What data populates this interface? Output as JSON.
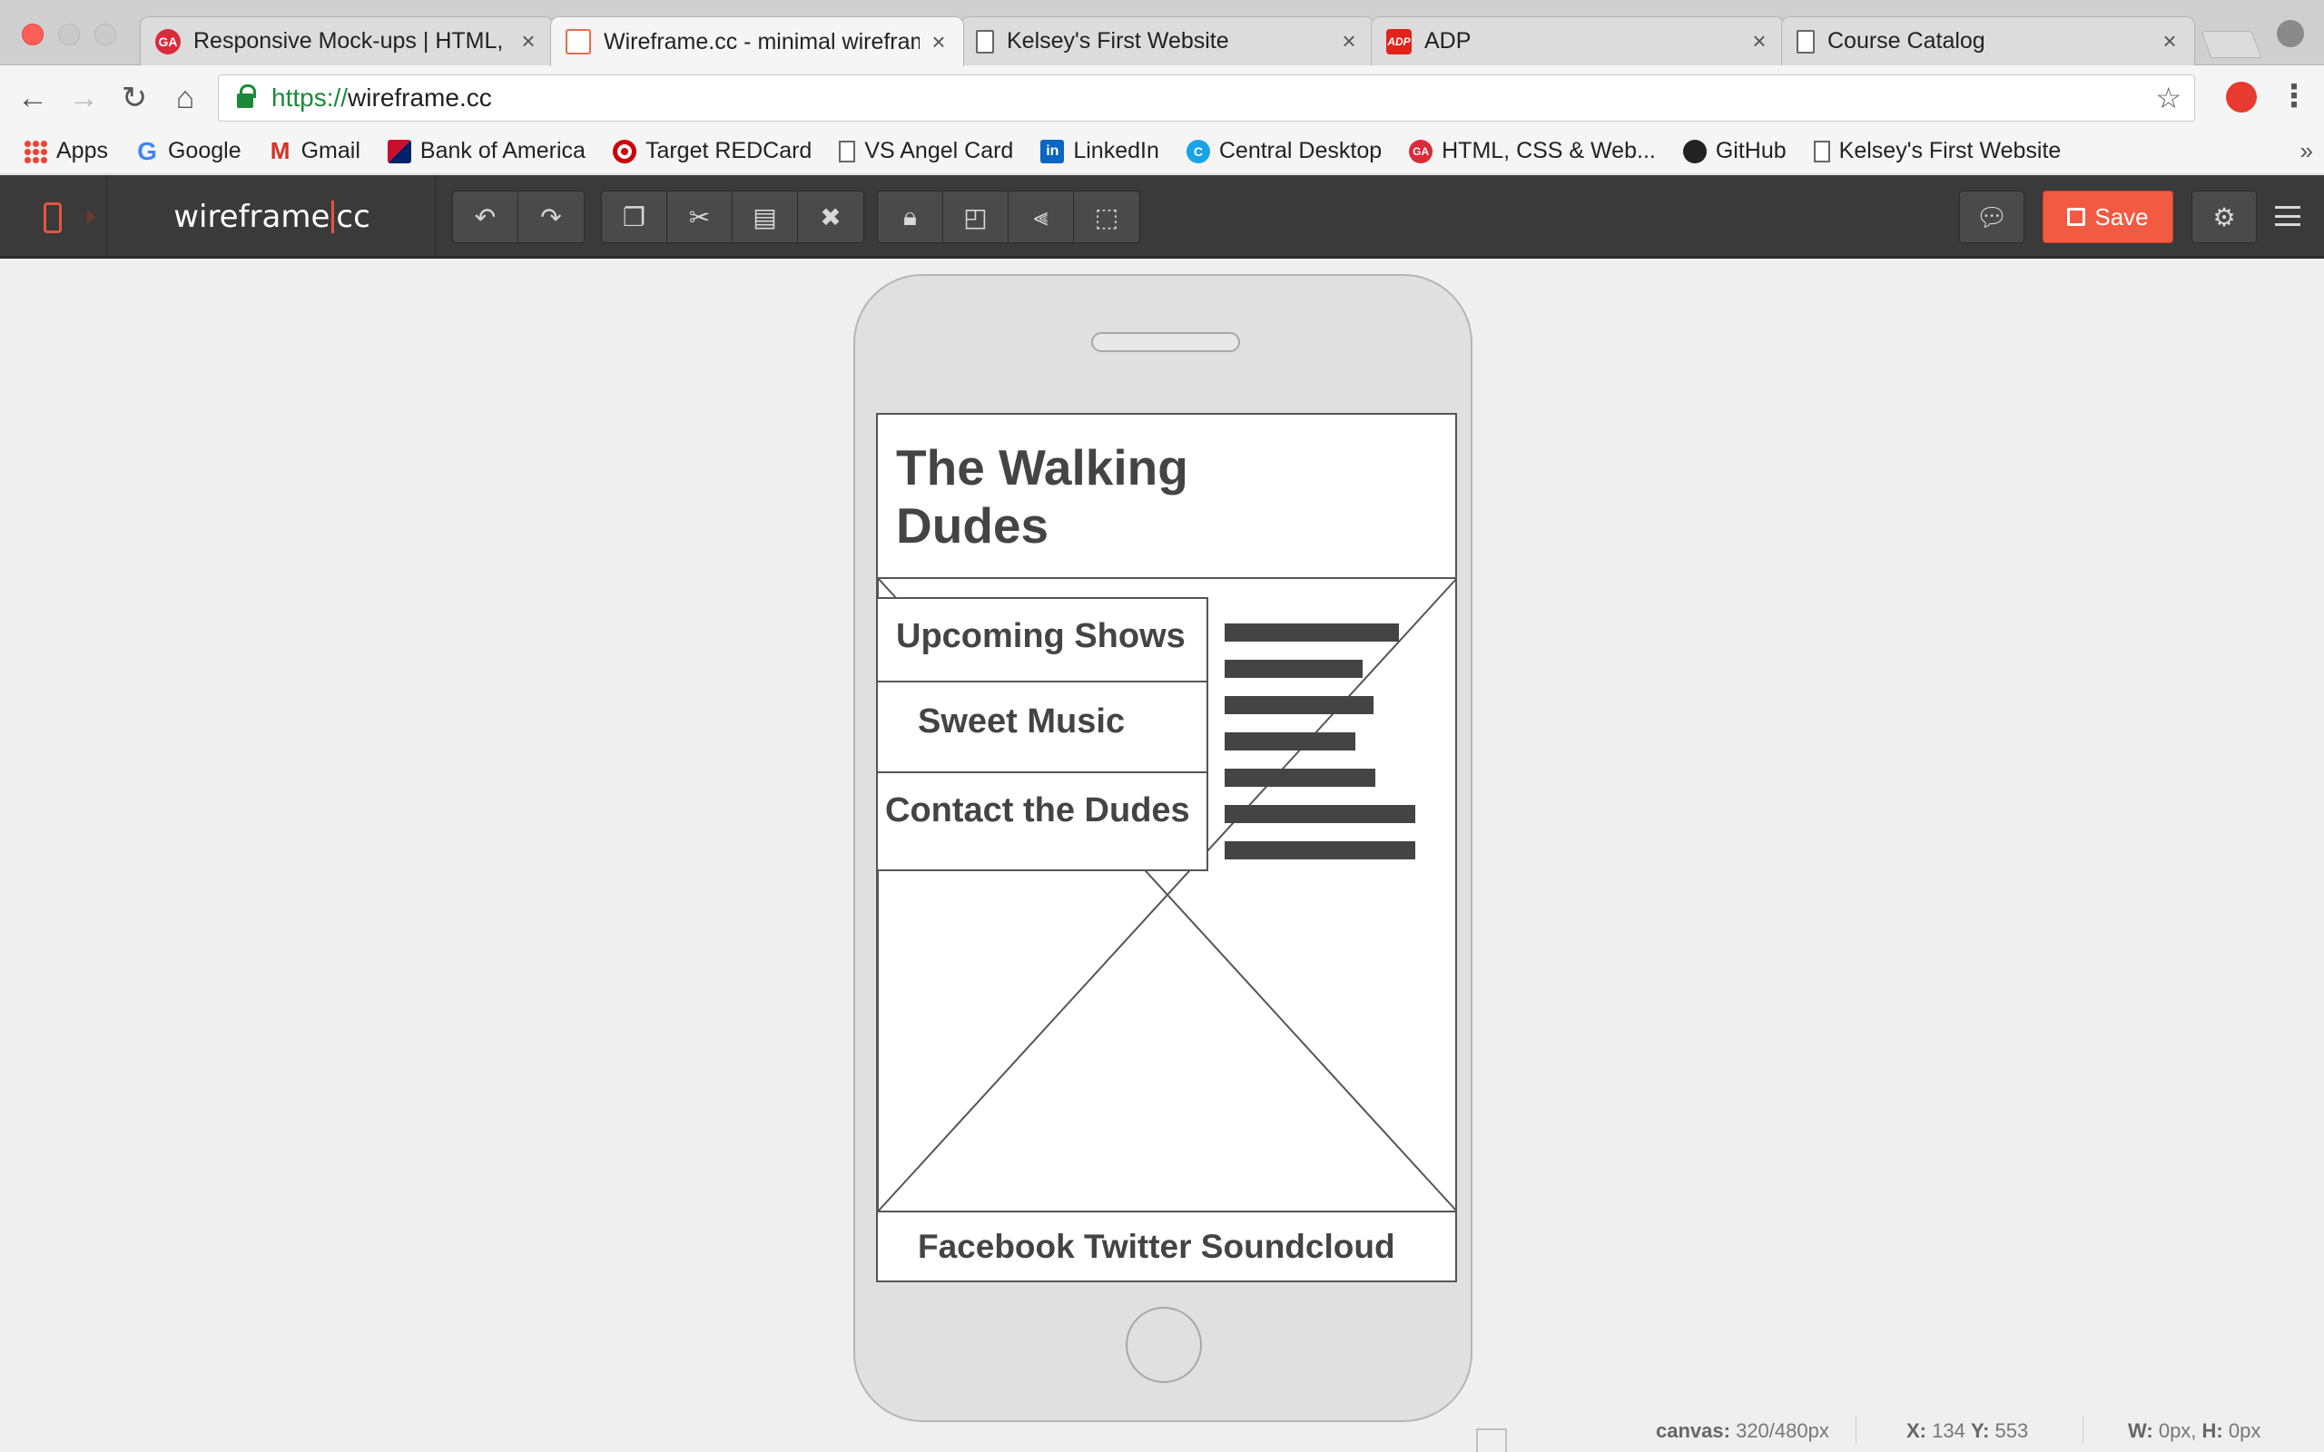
{
  "tabs": [
    {
      "title": "Responsive Mock-ups | HTML, CSS",
      "favicon": "ga-logo-icon",
      "fav_text": "GA",
      "active": false
    },
    {
      "title": "Wireframe.cc - minimal wireframe",
      "favicon": "wireframe-logo-icon",
      "fav_text": "",
      "active": true
    },
    {
      "title": "Kelsey's First Website",
      "favicon": "document-icon",
      "fav_text": "",
      "active": false
    },
    {
      "title": "ADP",
      "favicon": "adp-logo-icon",
      "fav_text": "ADP",
      "active": false
    },
    {
      "title": "Course Catalog",
      "favicon": "document-icon",
      "fav_text": "",
      "active": false
    }
  ],
  "tab_close_glyph": "×",
  "address_bar": {
    "scheme": "https://",
    "host": "wireframe.cc"
  },
  "bookmarks": [
    {
      "label": "Apps",
      "icon": "apps-grid-icon"
    },
    {
      "label": "Google",
      "icon": "google-icon"
    },
    {
      "label": "Gmail",
      "icon": "gmail-icon"
    },
    {
      "label": "Bank of America",
      "icon": "bank-of-america-icon"
    },
    {
      "label": "Target REDCard",
      "icon": "target-icon"
    },
    {
      "label": "VS Angel Card",
      "icon": "document-icon"
    },
    {
      "label": "LinkedIn",
      "icon": "linkedin-icon"
    },
    {
      "label": "Central Desktop",
      "icon": "central-desktop-icon"
    },
    {
      "label": "HTML, CSS & Web...",
      "icon": "ga-logo-icon"
    },
    {
      "label": "GitHub",
      "icon": "github-icon"
    },
    {
      "label": "Kelsey's First Website",
      "icon": "document-icon"
    }
  ],
  "bookmarks_overflow": "»",
  "app": {
    "brand_left": "wireframe",
    "brand_right": "cc",
    "save_label": "Save",
    "accent_color": "#f25a42"
  },
  "wireframe": {
    "title": "The Walking Dudes",
    "nav": [
      "Upcoming Shows",
      "Sweet Music",
      "Contact the Dudes"
    ],
    "footer": "Facebook Twitter Soundcloud"
  },
  "status": {
    "canvas_label": "canvas:",
    "canvas_value": "320/480px",
    "x_label": "X:",
    "x_value": "134",
    "y_label": "Y:",
    "y_value": "553",
    "w_label": "W:",
    "w_value": "0px,",
    "h_label": "H:",
    "h_value": "0px"
  }
}
